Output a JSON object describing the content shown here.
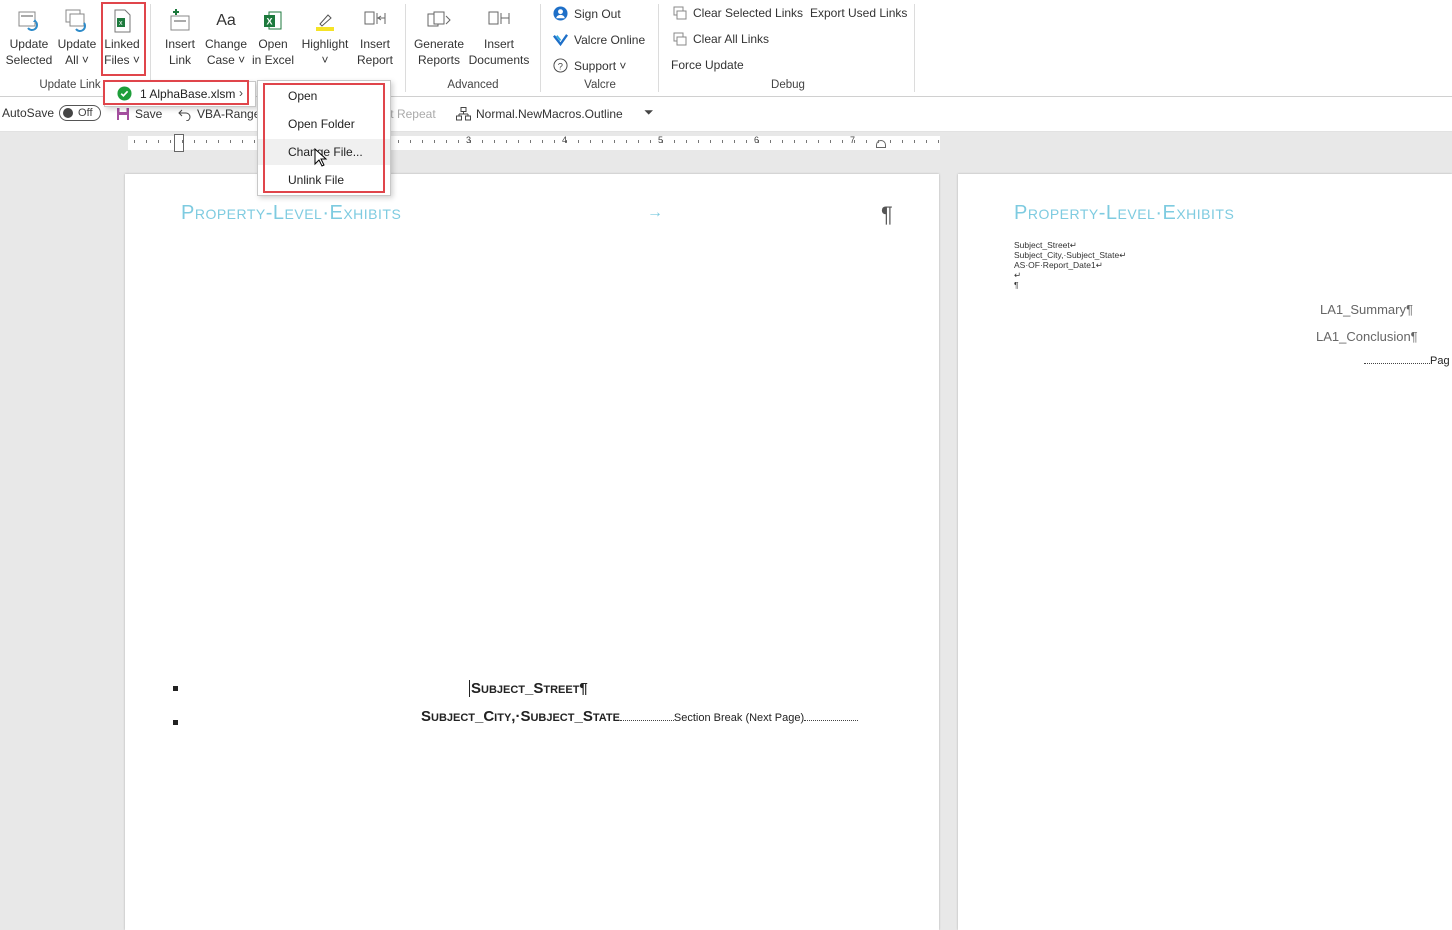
{
  "ribbon": {
    "update_selected": [
      "Update",
      "Selected"
    ],
    "update_all": [
      "Update",
      "All ˅"
    ],
    "linked_files": [
      "Linked",
      "Files ˅"
    ],
    "insert_link": [
      "Insert",
      "Link"
    ],
    "change_case": [
      "Change",
      "Case ˅"
    ],
    "open_in_excel": [
      "Open",
      "in Excel"
    ],
    "highlight": [
      "Highlight",
      "˅"
    ],
    "insert_report": [
      "Insert",
      "Report"
    ],
    "generate_reports": [
      "Generate",
      "Reports"
    ],
    "insert_documents": [
      "Insert",
      "Documents"
    ],
    "sign_out": "Sign Out",
    "valcre_online": "Valcre Online",
    "support": "Support ˅",
    "clear_selected_links": "Clear Selected Links",
    "export_used_links": "Export Used Links",
    "clear_all_links": "Clear All Links",
    "force_update": "Force Update",
    "groups": {
      "update_links": "Update Link",
      "advanced": "Advanced",
      "valcre": "Valcre",
      "debug": "Debug"
    }
  },
  "qat": {
    "autosave": "AutoSave",
    "toggle": "Off",
    "save": "Save",
    "vba_range": "VBA-Range",
    "repeat": "'t Repeat",
    "macro": "Normal.NewMacros.Outline"
  },
  "ruler": {
    "numbers": [
      "3",
      "4",
      "5",
      "6",
      "7"
    ]
  },
  "file_menu": {
    "item": "1 AlphaBase.xlsm"
  },
  "submenu": {
    "items": [
      "Open",
      "Open Folder",
      "Change File...",
      "Unlink File"
    ]
  },
  "page1": {
    "heading": "Property-Level·Exhibits",
    "arrow": "→",
    "pilcrow": "¶",
    "line1": "Subject_Street¶",
    "line2": "Subject_City,·Subject_State",
    "section_break": "Section Break (Next Page)"
  },
  "page2": {
    "heading": "Property-Level·Exhibits",
    "l1": "Subject_Street↵",
    "l2": "Subject_City,·Subject_State↵",
    "l3": "AS·OF·Report_Date1↵",
    "l4": "↵",
    "l5": "¶",
    "summary": "LA1_Summary¶",
    "conclusion": "LA1_Conclusion¶",
    "pag": "Pag"
  },
  "colors": {
    "accent_red": "#e0454b",
    "heading": "#7ecbe0",
    "valcre_blue": "#1e6fc8",
    "excel_green": "#1d7a3d"
  }
}
